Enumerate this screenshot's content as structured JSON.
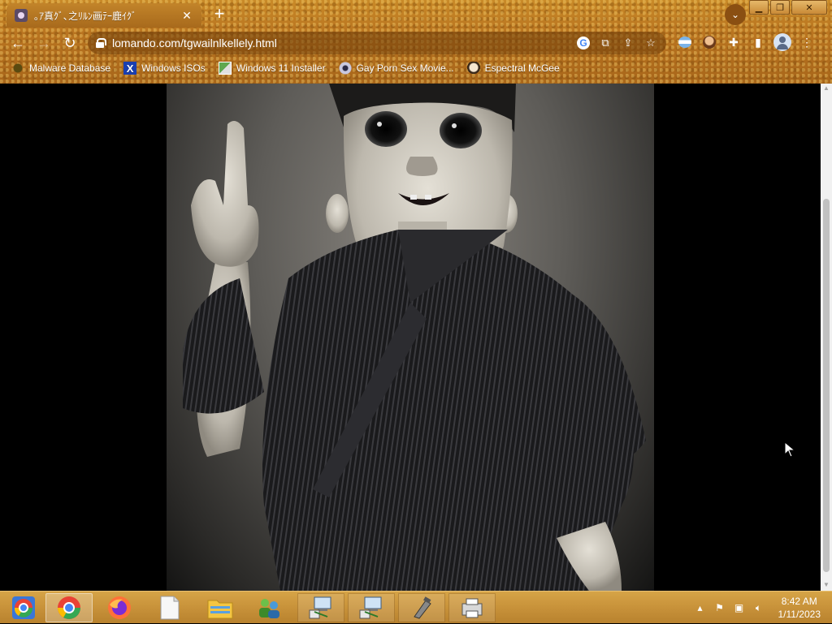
{
  "browser": {
    "tab": {
      "title": "｡ｱ真ｸﾞ､之ﾘﾙﾝ画ﾃｰ鹿ｲｸﾞ"
    },
    "address": {
      "url": "lomando.com/tgwailnlkellely.html"
    },
    "bookmarks": [
      {
        "label": "Malware Database",
        "icon": "bug-icon"
      },
      {
        "label": "Windows ISOs",
        "icon": "x-icon"
      },
      {
        "label": "Windows 11 Installer",
        "icon": "windows-image-icon"
      },
      {
        "label": "Gay Porn Sex Movie...",
        "icon": "disc-icon"
      },
      {
        "label": "Espectral McGee",
        "icon": "ghost-icon"
      }
    ]
  },
  "page": {
    "image_subject": "grayscale painting of a child in a striped kimono raising one finger"
  },
  "taskbar": {
    "apps": [
      {
        "name": "chrome-multicolor",
        "icon": "chrome-icon"
      },
      {
        "name": "chrome",
        "icon": "chrome-icon"
      },
      {
        "name": "firefox",
        "icon": "firefox-icon"
      },
      {
        "name": "blank-document",
        "icon": "document-icon"
      },
      {
        "name": "file-explorer",
        "icon": "folder-icon"
      },
      {
        "name": "users",
        "icon": "users-icon"
      },
      {
        "name": "network-computer-1",
        "icon": "network-computer-icon"
      },
      {
        "name": "network-computer-2",
        "icon": "network-computer-icon"
      },
      {
        "name": "tool",
        "icon": "tool-icon"
      },
      {
        "name": "printer",
        "icon": "printer-icon"
      }
    ],
    "clock": {
      "time": "8:42 AM",
      "date": "1/11/2023"
    }
  }
}
